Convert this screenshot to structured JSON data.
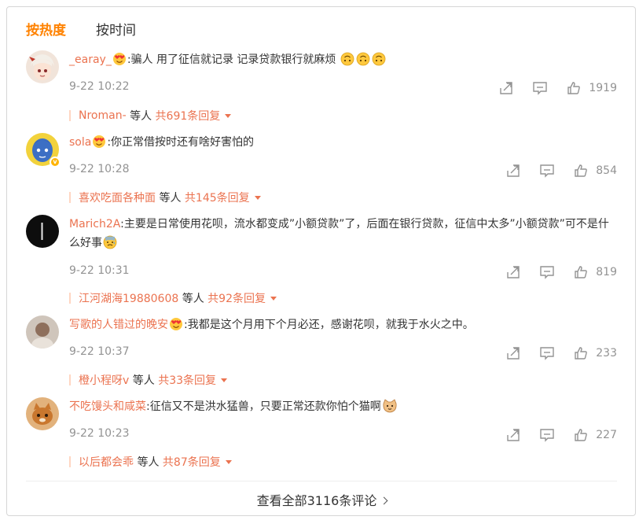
{
  "tabs": [
    {
      "label": "按热度",
      "active": true
    },
    {
      "label": "按时间",
      "active": false
    }
  ],
  "comments": [
    {
      "user": "_earay_",
      "text_before": ":骗人 用了征信就记录 记录贷款银行就麻烦",
      "time": "9-22 10:22",
      "likes": "1919",
      "reply_user": "Nroman-",
      "reply_mid": "等人",
      "reply_count": "共691条回复",
      "avatar_color": "#e8d5c8"
    },
    {
      "user": "sola",
      "text_before": ":你正常借按时还有啥好害怕的",
      "time": "9-22 10:28",
      "likes": "854",
      "reply_user": "喜欢吃面各种面",
      "reply_mid": "等人",
      "reply_count": "共145条回复",
      "avatar_color": "#3a6fb5"
    },
    {
      "user": "Marich2A",
      "text_before": ":主要是日常使用花呗，流水都变成”小额贷款”了，后面在银行贷款，征信中太多”小额贷款”可不是什么好事",
      "time": "9-22 10:31",
      "likes": "819",
      "reply_user": "江河湖海19880608",
      "reply_mid": "等人",
      "reply_count": "共92条回复",
      "avatar_color": "#111111"
    },
    {
      "user": "写歌的人错过的晚安",
      "text_before": ":我都是这个月用下个月必还，感谢花呗，就我于水火之中。",
      "time": "9-22 10:37",
      "likes": "233",
      "reply_user": "橙小程呀v",
      "reply_mid": "等人",
      "reply_count": "共33条回复",
      "avatar_color": "#b89d8a"
    },
    {
      "user": "不吃馒头和咸菜",
      "text_before": ":征信又不是洪水猛兽，只要正常还款你怕个猫啊",
      "time": "9-22 10:23",
      "likes": "227",
      "reply_user": "以后都会乖",
      "reply_mid": "等人",
      "reply_count": "共87条回复",
      "avatar_color": "#d99a5a"
    }
  ],
  "footer": {
    "view_all": "查看全部3116条评论"
  },
  "colors": {
    "accent": "#ff8200",
    "username": "#eb7350",
    "meta": "#939393"
  }
}
